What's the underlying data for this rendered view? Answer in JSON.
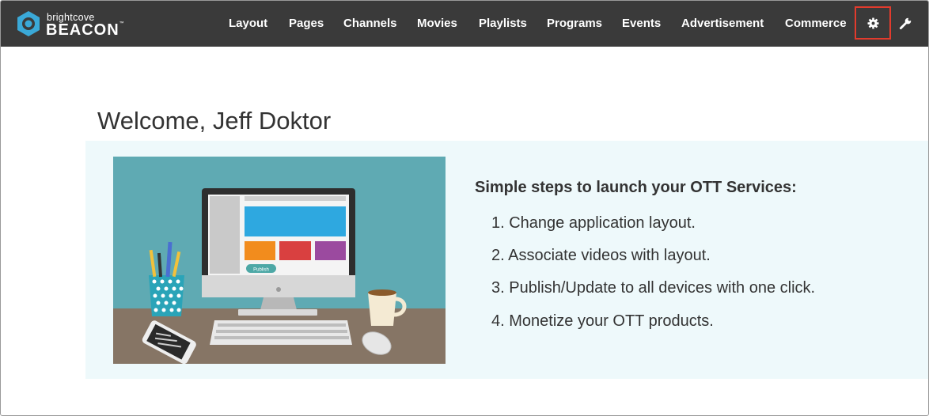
{
  "brand": {
    "small": "brightcove",
    "big": "BEACON",
    "trademark": "™",
    "accent": "#3aa9d8"
  },
  "nav": {
    "items": [
      {
        "label": "Layout"
      },
      {
        "label": "Pages"
      },
      {
        "label": "Channels"
      },
      {
        "label": "Movies"
      },
      {
        "label": "Playlists"
      },
      {
        "label": "Programs"
      },
      {
        "label": "Events"
      },
      {
        "label": "Advertisement"
      },
      {
        "label": "Commerce"
      }
    ],
    "settings_icon": "gear-icon",
    "tools_icon": "wrench-icon",
    "highlight_color": "#e23b2d",
    "bar_color": "#3a3a3a"
  },
  "welcome": {
    "title": "Welcome, Jeff Doktor"
  },
  "illustration": {
    "publish_label": "Publish"
  },
  "steps": {
    "title": "Simple steps to launch your OTT Services:",
    "items": [
      "1. Change application layout.",
      "2. Associate videos with layout.",
      "3. Publish/Update to all devices with one click.",
      "4. Monetize your OTT products."
    ]
  }
}
